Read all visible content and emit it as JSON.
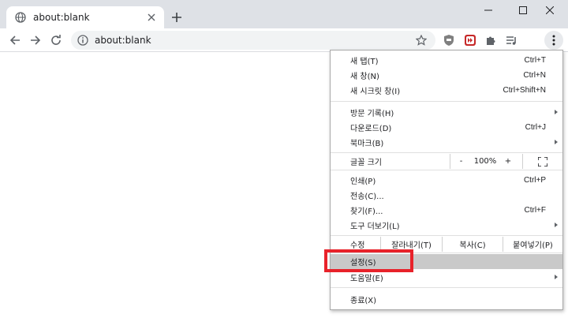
{
  "tab": {
    "title": "about:blank"
  },
  "omnibox": {
    "url": "about:blank"
  },
  "menu": {
    "items_group1": [
      {
        "label": "새 탭(T)",
        "shortcut": "Ctrl+T"
      },
      {
        "label": "새 창(N)",
        "shortcut": "Ctrl+N"
      },
      {
        "label": "새 시크릿 창(I)",
        "shortcut": "Ctrl+Shift+N"
      }
    ],
    "items_group2": [
      {
        "label": "방문 기록(H)",
        "shortcut": ""
      },
      {
        "label": "다운로드(D)",
        "shortcut": "Ctrl+J"
      },
      {
        "label": "북마크(B)",
        "shortcut": ""
      }
    ],
    "zoom": {
      "label": "글꼴 크기",
      "minus": "-",
      "value": "100%",
      "plus": "+"
    },
    "items_group3": [
      {
        "label": "인쇄(P)",
        "shortcut": "Ctrl+P"
      },
      {
        "label": "전송(C)...",
        "shortcut": ""
      },
      {
        "label": "찾기(F)...",
        "shortcut": "Ctrl+F"
      },
      {
        "label": "도구 더보기(L)",
        "shortcut": ""
      }
    ],
    "edit": {
      "label": "수정",
      "cut": "잘라내기(T)",
      "copy": "복사(C)",
      "paste": "붙여넣기(P)"
    },
    "settings": {
      "label": "설정(S)"
    },
    "help": {
      "label": "도움말(E)"
    },
    "exit": {
      "label": "종료(X)"
    }
  }
}
